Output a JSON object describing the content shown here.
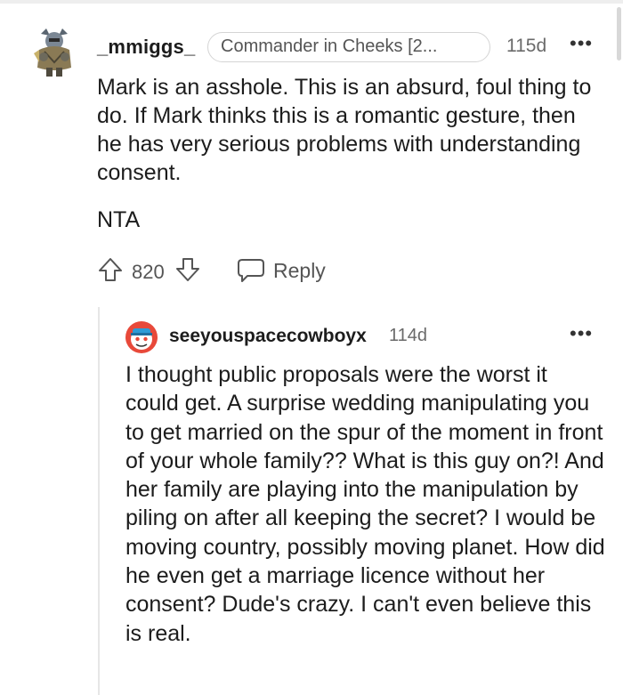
{
  "comment": {
    "author": "_mmiggs_",
    "flair": "Commander in Cheeks [2...",
    "age": "115d",
    "more": "•••",
    "paragraphs": [
      "Mark is an asshole. This is an absurd, foul thing to do. If Mark thinks this is a romantic gesture, then he has very serious problems with understanding consent.",
      "NTA"
    ],
    "score": "820",
    "reply_label": "Reply"
  },
  "reply": {
    "author": "seeyouspacecowboyx",
    "age": "114d",
    "more": "•••",
    "text": "I thought public proposals were the worst it could get. A surprise wedding manipulating you to get married on the spur of the moment in front of your whole family?? What is this guy on?! And her family are playing into the manipulation by piling on after all keeping the secret? I would be moving country, possibly moving planet. How did he even get a marriage licence without her consent? Dude's crazy. I can't even believe this is real."
  },
  "colors": {
    "text": "#1c1c1c",
    "meta": "#6a6a6a",
    "snoo_red": "#e8493a",
    "snoo_blue": "#2e9bd6"
  },
  "icons": [
    "avatar-knight",
    "upvote-arrow-icon",
    "downvote-arrow-icon",
    "reply-bubble-icon",
    "more-dots-icon",
    "snoo-avatar"
  ]
}
